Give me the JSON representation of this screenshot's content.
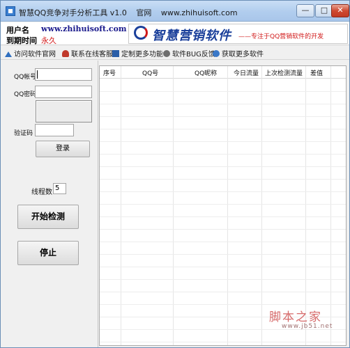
{
  "window": {
    "title": "智慧QQ竞争对手分析工具 v1.0",
    "official_label": "官网",
    "official_url": "www.zhihuisoft.com",
    "min_label": "—",
    "max_label": "□",
    "close_label": "✕"
  },
  "header": {
    "user_label": "用户名",
    "user_value": "www.zhihuisoft.com",
    "expire_label": "到期时间",
    "expire_value": "永久",
    "brand": "智慧营销软件",
    "slogan": "——专注于QQ营销软件的开发"
  },
  "toolbar": {
    "items": [
      {
        "label": "访问软件官网",
        "icon": "home-icon"
      },
      {
        "label": "联系在线客服",
        "icon": "user-icon"
      },
      {
        "label": "定制更多功能",
        "icon": "function-icon"
      },
      {
        "label": "软件BUG反馈",
        "icon": "bug-icon"
      },
      {
        "label": "获取更多软件",
        "icon": "download-icon"
      }
    ]
  },
  "login": {
    "qq_label": "QQ帐号",
    "qq_value": "",
    "password_label": "QQ密码",
    "password_value": "",
    "captcha_label": "验证码",
    "captcha_value": "",
    "login_button": "登录"
  },
  "controls": {
    "thread_label": "线程数",
    "thread_value": "5",
    "start_button": "开始检测",
    "stop_button": "停止"
  },
  "table": {
    "columns": [
      "序号",
      "QQ号",
      "QQ昵称",
      "今日流量",
      "上次检测流量",
      "差值"
    ],
    "rows": []
  },
  "watermark": {
    "text": "脚本之家",
    "url": "www.jb51.net"
  }
}
